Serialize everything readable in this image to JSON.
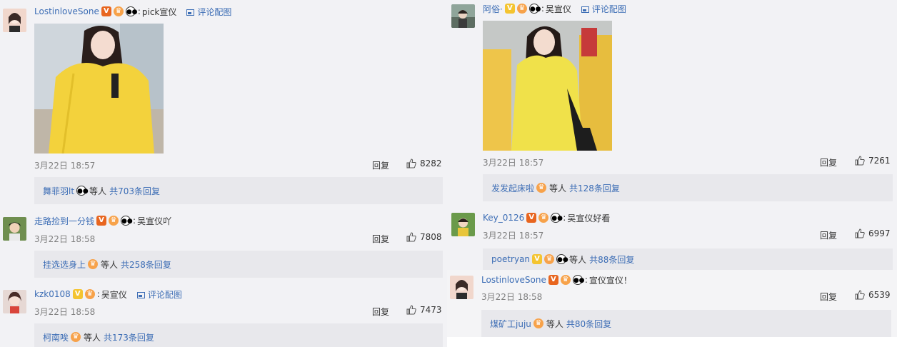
{
  "left": {
    "comments": [
      {
        "username": "LostinloveSone",
        "text": "pick宣仪",
        "pic_link": "评论配图",
        "time": "3月22日 18:57",
        "reply": "回复",
        "likes": "8282",
        "sub_user": "舞菲羽lt",
        "sub_mid": "等人",
        "sub_count": "共703条回复"
      },
      {
        "username": "走路捡到一分钱",
        "text": "吴宣仪吖",
        "time": "3月22日 18:58",
        "reply": "回复",
        "likes": "7808",
        "sub_user": "挂选选身上",
        "sub_mid": "等人",
        "sub_count": "共258条回复"
      },
      {
        "username": "kzk0108",
        "text": "吴宣仪",
        "pic_link": "评论配图",
        "time": "3月22日 18:58",
        "reply": "回复",
        "likes": "7473",
        "sub_user": "柯南唉",
        "sub_mid": "等人",
        "sub_count": "共173条回复"
      }
    ]
  },
  "right": {
    "comments": [
      {
        "username": "阿俗·",
        "text": "吴宣仪",
        "pic_link": "评论配图",
        "time": "3月22日 18:57",
        "reply": "回复",
        "likes": "7261",
        "sub_user": "发发起床啦",
        "sub_mid": "等人",
        "sub_count": "共128条回复"
      },
      {
        "username": "Key_0126",
        "text": "吴宣仪好看",
        "time": "3月22日 18:57",
        "reply": "回复",
        "likes": "6997",
        "sub_user": "poetryan",
        "sub_mid": "等人",
        "sub_count": "共88条回复"
      },
      {
        "username": "LostinloveSone",
        "text": "宣仪宣仪！",
        "time": "3月22日 18:58",
        "reply": "回复",
        "likes": "6539",
        "sub_user": "煤矿工juju",
        "sub_mid": "等人",
        "sub_count": "共80条回复"
      }
    ]
  },
  "badges": {
    "v_red": "V",
    "v_yellow": "V",
    "crown": "♛",
    "panda": "●●"
  },
  "colors": {
    "username": "#3c6db5",
    "panel_bg": "#f2f2f5",
    "subbox_bg": "#e8e8ec",
    "hoodie_yellow": "#f3d23c"
  }
}
